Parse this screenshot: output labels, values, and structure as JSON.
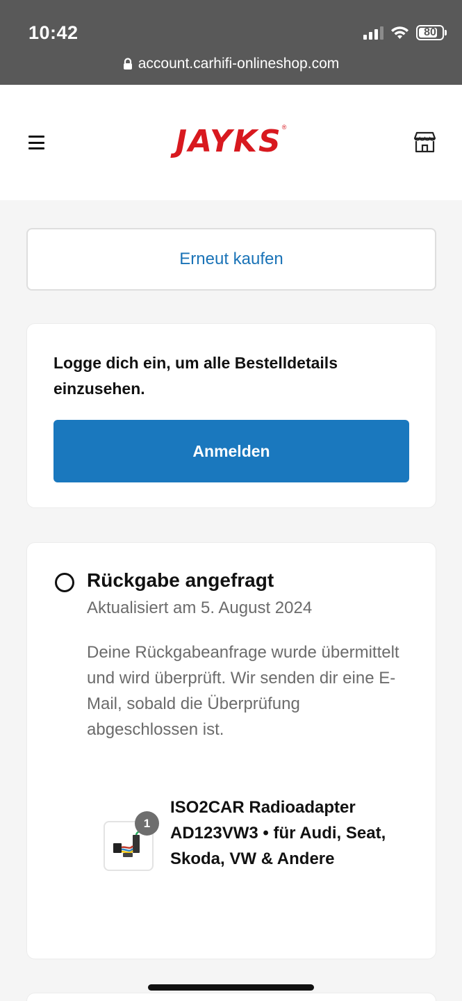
{
  "status_bar": {
    "time": "10:42",
    "battery": "80",
    "icons": [
      "signal-icon",
      "wifi-icon",
      "battery-icon"
    ]
  },
  "browser": {
    "url": "account.carhifi-onlineshop.com",
    "icon": "lock-icon"
  },
  "header": {
    "logo": "JAYKS",
    "menu_icon": "hamburger-menu-icon",
    "store_icon": "store-icon"
  },
  "actions": {
    "buy_again": "Erneut kaufen"
  },
  "login_card": {
    "text": "Logge dich ein, um alle Bestelldetails einzusehen.",
    "button": "Anmelden"
  },
  "status_card": {
    "title": "Rückgabe angefragt",
    "date": "Aktualisiert am 5. August 2024",
    "message": "Deine Rückgabeanfrage wurde übermittelt und wird überprüft. Wir senden dir eine E-Mail, sobald die Überprüfung abgeschlossen ist.",
    "product": {
      "name": "ISO2CAR Radioadapter AD123VW3 • für Audi, Seat, Skoda, VW & Andere",
      "quantity": "1"
    }
  },
  "colors": {
    "accent": "#1a78be",
    "link": "#1a73b7",
    "brand": "#d8191f",
    "status_bar": "#595959"
  }
}
